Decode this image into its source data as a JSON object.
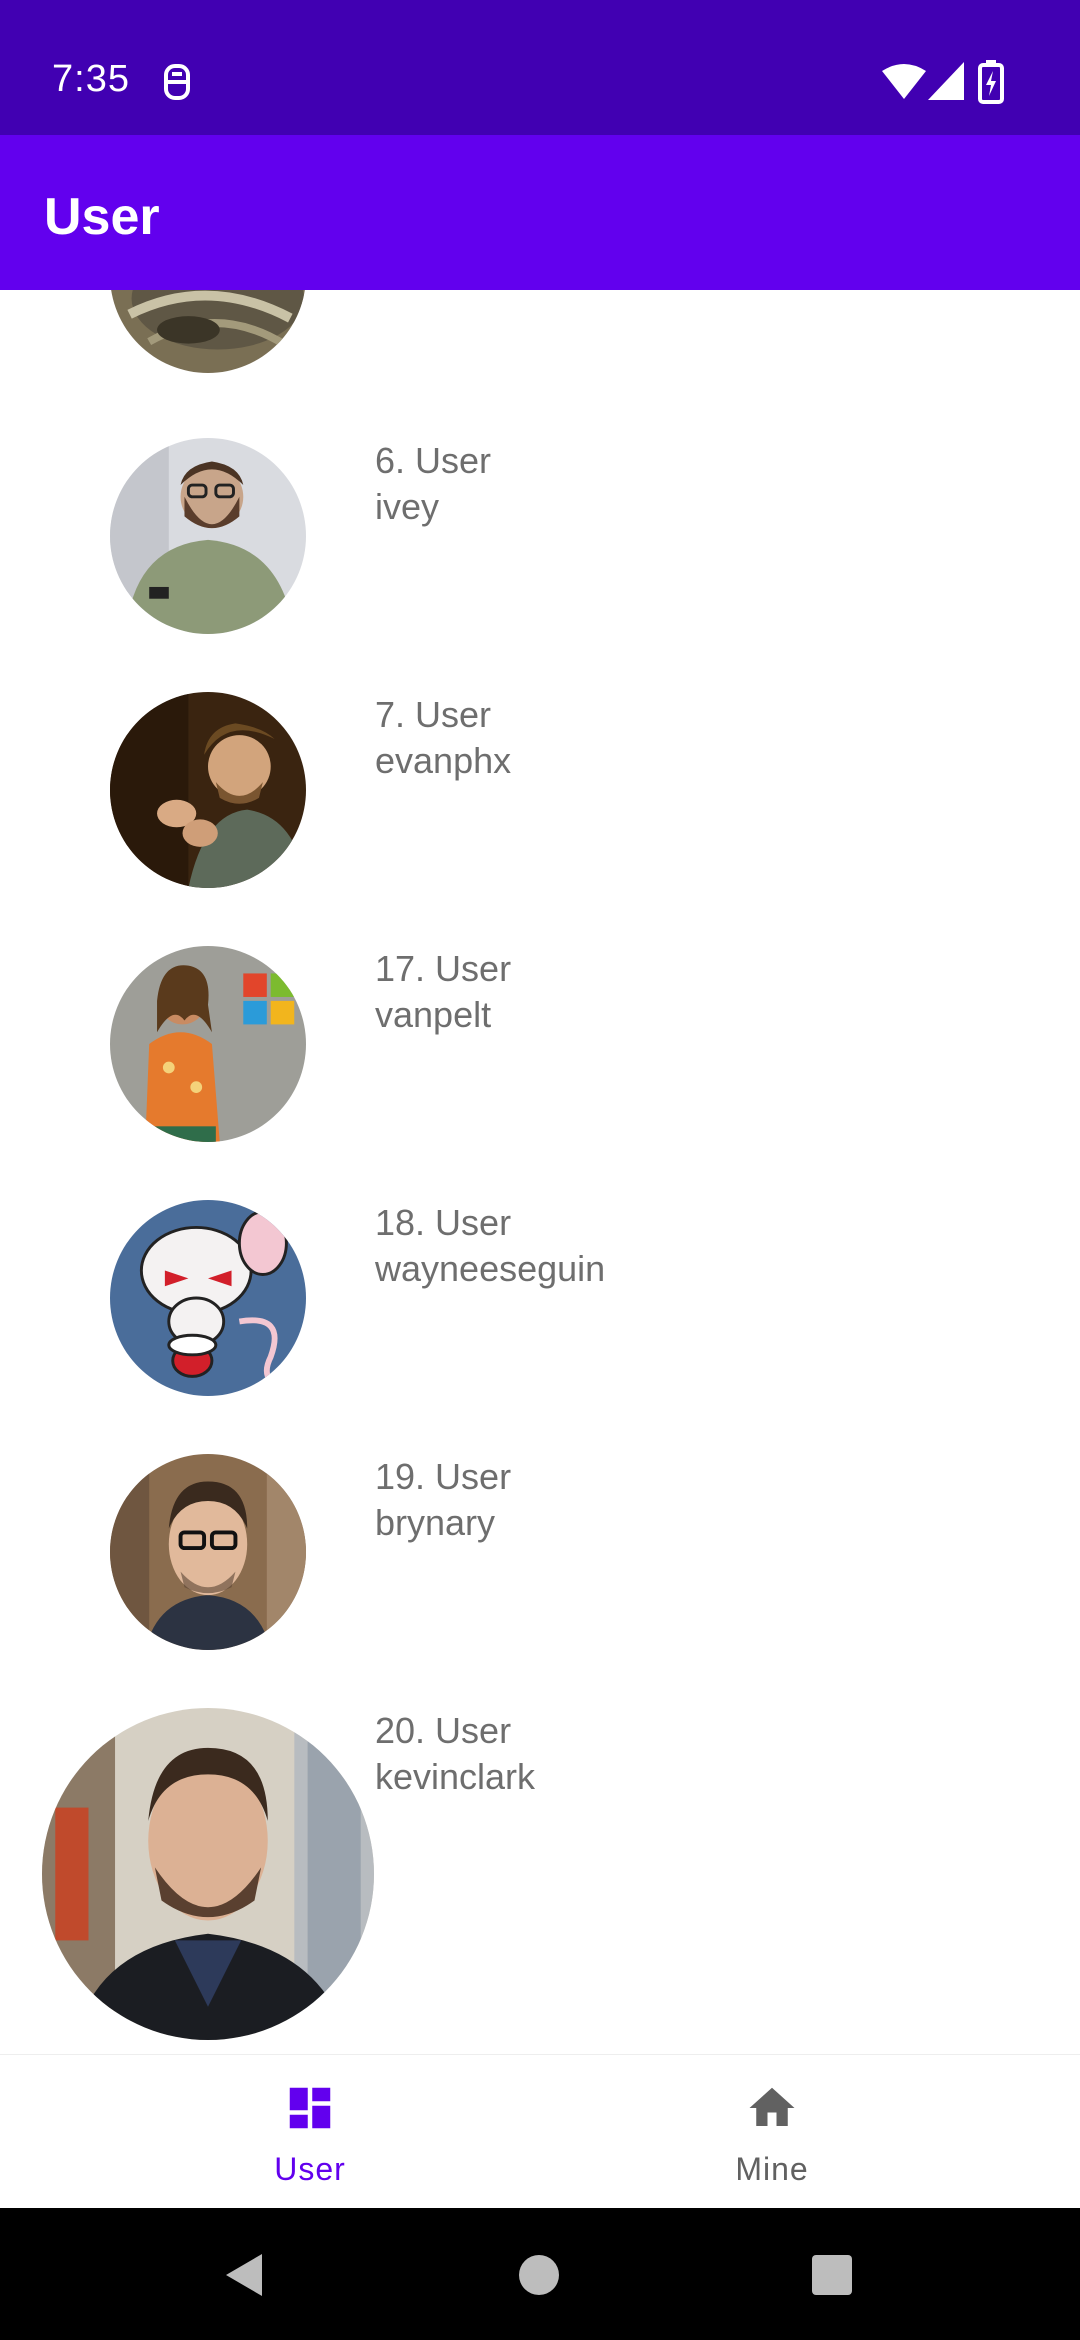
{
  "status_bar": {
    "time": "7:35"
  },
  "app_bar": {
    "title": "User"
  },
  "users": [
    {
      "rank": "6. User",
      "login": "ivey"
    },
    {
      "rank": "7. User",
      "login": "evanphx"
    },
    {
      "rank": "17. User",
      "login": "vanpelt"
    },
    {
      "rank": "18. User",
      "login": "wayneeseguin"
    },
    {
      "rank": "19. User",
      "login": "brynary"
    },
    {
      "rank": "20. User",
      "login": "kevinclark"
    }
  ],
  "bottom_nav": {
    "items": [
      {
        "label": "User",
        "icon": "dashboard-icon",
        "selected": true
      },
      {
        "label": "Mine",
        "icon": "home-icon",
        "selected": false
      }
    ]
  },
  "colors": {
    "status_bar": "#4100b2",
    "app_bar": "#6200ee",
    "accent": "#6200ee",
    "inactive": "#616161",
    "user_text": "#6e6e6e"
  }
}
